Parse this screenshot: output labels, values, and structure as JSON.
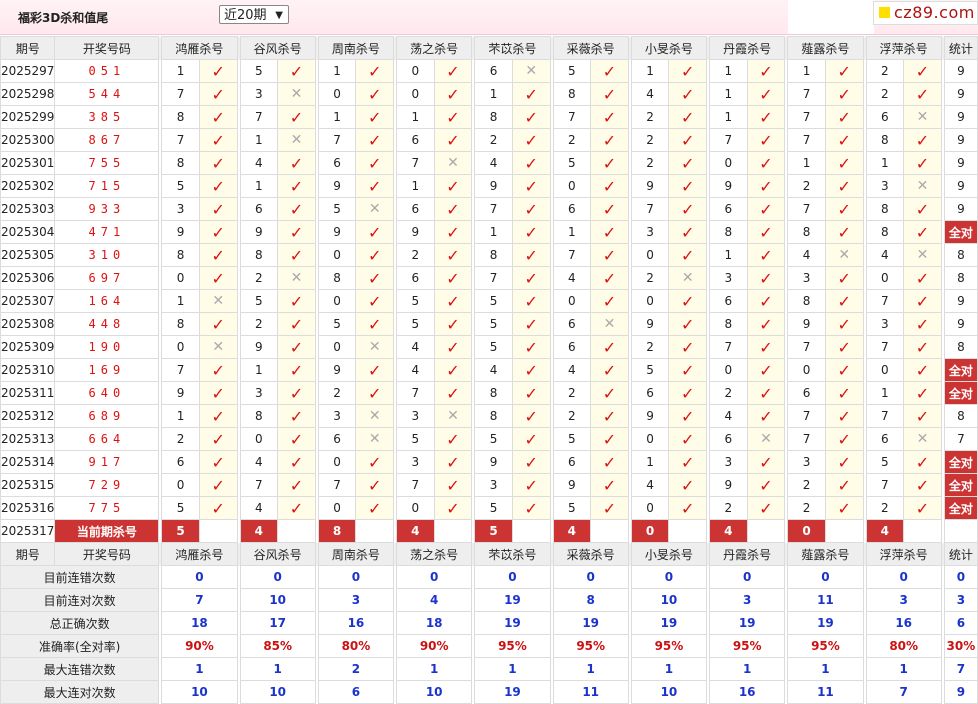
{
  "header": {
    "title": "福彩3D杀和值尾",
    "period_select": "近20期",
    "logo": "cz89.com"
  },
  "table": {
    "col_issue": "期号",
    "col_numbers": "开奖号码",
    "col_stat": "统计",
    "experts": [
      "鸿雁杀号",
      "谷风杀号",
      "周南杀号",
      "荡之杀号",
      "芣苡杀号",
      "采薇杀号",
      "小旻杀号",
      "丹霞杀号",
      "薤露杀号",
      "浮萍杀号"
    ],
    "all_right_label": "全对",
    "rows": [
      {
        "issue": "2025297",
        "numbers": "051",
        "kills": [
          1,
          5,
          1,
          0,
          6,
          5,
          1,
          1,
          1,
          2
        ],
        "hit": [
          1,
          1,
          1,
          1,
          0,
          1,
          1,
          1,
          1,
          1
        ],
        "stat": "9"
      },
      {
        "issue": "2025298",
        "numbers": "544",
        "kills": [
          7,
          3,
          0,
          0,
          1,
          8,
          4,
          1,
          7,
          2
        ],
        "hit": [
          1,
          0,
          1,
          1,
          1,
          1,
          1,
          1,
          1,
          1
        ],
        "stat": "9"
      },
      {
        "issue": "2025299",
        "numbers": "385",
        "kills": [
          8,
          7,
          1,
          1,
          8,
          7,
          2,
          1,
          7,
          6
        ],
        "hit": [
          1,
          1,
          1,
          1,
          1,
          1,
          1,
          1,
          1,
          0
        ],
        "stat": "9"
      },
      {
        "issue": "2025300",
        "numbers": "867",
        "kills": [
          7,
          1,
          7,
          6,
          2,
          2,
          2,
          7,
          7,
          8
        ],
        "hit": [
          1,
          0,
          1,
          1,
          1,
          1,
          1,
          1,
          1,
          1
        ],
        "stat": "9"
      },
      {
        "issue": "2025301",
        "numbers": "755",
        "kills": [
          8,
          4,
          6,
          7,
          4,
          5,
          2,
          0,
          1,
          1
        ],
        "hit": [
          1,
          1,
          1,
          0,
          1,
          1,
          1,
          1,
          1,
          1
        ],
        "stat": "9"
      },
      {
        "issue": "2025302",
        "numbers": "715",
        "kills": [
          5,
          1,
          9,
          1,
          9,
          0,
          9,
          9,
          2,
          3
        ],
        "hit": [
          1,
          1,
          1,
          1,
          1,
          1,
          1,
          1,
          1,
          0
        ],
        "stat": "9"
      },
      {
        "issue": "2025303",
        "numbers": "933",
        "kills": [
          3,
          6,
          5,
          6,
          7,
          6,
          7,
          6,
          7,
          8
        ],
        "hit": [
          1,
          1,
          0,
          1,
          1,
          1,
          1,
          1,
          1,
          1
        ],
        "stat": "9"
      },
      {
        "issue": "2025304",
        "numbers": "471",
        "kills": [
          9,
          9,
          9,
          9,
          1,
          1,
          3,
          8,
          8,
          8
        ],
        "hit": [
          1,
          1,
          1,
          1,
          1,
          1,
          1,
          1,
          1,
          1
        ],
        "stat": "全对"
      },
      {
        "issue": "2025305",
        "numbers": "310",
        "kills": [
          8,
          8,
          0,
          2,
          8,
          7,
          0,
          1,
          4,
          4
        ],
        "hit": [
          1,
          1,
          1,
          1,
          1,
          1,
          1,
          1,
          0,
          0
        ],
        "stat": "8"
      },
      {
        "issue": "2025306",
        "numbers": "697",
        "kills": [
          0,
          2,
          8,
          6,
          7,
          4,
          2,
          3,
          3,
          0
        ],
        "hit": [
          1,
          0,
          1,
          1,
          1,
          1,
          0,
          1,
          1,
          1
        ],
        "stat": "8"
      },
      {
        "issue": "2025307",
        "numbers": "164",
        "kills": [
          1,
          5,
          0,
          5,
          5,
          0,
          0,
          6,
          8,
          7
        ],
        "hit": [
          0,
          1,
          1,
          1,
          1,
          1,
          1,
          1,
          1,
          1
        ],
        "stat": "9"
      },
      {
        "issue": "2025308",
        "numbers": "448",
        "kills": [
          8,
          2,
          5,
          5,
          5,
          6,
          9,
          8,
          9,
          3
        ],
        "hit": [
          1,
          1,
          1,
          1,
          1,
          0,
          1,
          1,
          1,
          1
        ],
        "stat": "9"
      },
      {
        "issue": "2025309",
        "numbers": "190",
        "kills": [
          0,
          9,
          0,
          4,
          5,
          6,
          2,
          7,
          7,
          7
        ],
        "hit": [
          0,
          1,
          0,
          1,
          1,
          1,
          1,
          1,
          1,
          1
        ],
        "stat": "8"
      },
      {
        "issue": "2025310",
        "numbers": "169",
        "kills": [
          7,
          1,
          9,
          4,
          4,
          4,
          5,
          0,
          0,
          0
        ],
        "hit": [
          1,
          1,
          1,
          1,
          1,
          1,
          1,
          1,
          1,
          1
        ],
        "stat": "全对"
      },
      {
        "issue": "2025311",
        "numbers": "640",
        "kills": [
          9,
          3,
          2,
          7,
          8,
          2,
          6,
          2,
          6,
          1
        ],
        "hit": [
          1,
          1,
          1,
          1,
          1,
          1,
          1,
          1,
          1,
          1
        ],
        "stat": "全对"
      },
      {
        "issue": "2025312",
        "numbers": "689",
        "kills": [
          1,
          8,
          3,
          3,
          8,
          2,
          9,
          4,
          7,
          7
        ],
        "hit": [
          1,
          1,
          0,
          0,
          1,
          1,
          1,
          1,
          1,
          1
        ],
        "stat": "8"
      },
      {
        "issue": "2025313",
        "numbers": "664",
        "kills": [
          2,
          0,
          6,
          5,
          5,
          5,
          0,
          6,
          7,
          6
        ],
        "hit": [
          1,
          1,
          0,
          1,
          1,
          1,
          1,
          0,
          1,
          0
        ],
        "stat": "7"
      },
      {
        "issue": "2025314",
        "numbers": "917",
        "kills": [
          6,
          4,
          0,
          3,
          9,
          6,
          1,
          3,
          3,
          5
        ],
        "hit": [
          1,
          1,
          1,
          1,
          1,
          1,
          1,
          1,
          1,
          1
        ],
        "stat": "全对"
      },
      {
        "issue": "2025315",
        "numbers": "729",
        "kills": [
          0,
          7,
          7,
          7,
          3,
          9,
          4,
          9,
          2,
          7
        ],
        "hit": [
          1,
          1,
          1,
          1,
          1,
          1,
          1,
          1,
          1,
          1
        ],
        "stat": "全对"
      },
      {
        "issue": "2025316",
        "numbers": "775",
        "kills": [
          5,
          4,
          0,
          0,
          5,
          5,
          0,
          2,
          2,
          2
        ],
        "hit": [
          1,
          1,
          1,
          1,
          1,
          1,
          1,
          1,
          1,
          1
        ],
        "stat": "全对"
      }
    ],
    "current": {
      "issue": "2025317",
      "label": "当前期杀号",
      "kills": [
        "5",
        "4",
        "8",
        "4",
        "5",
        "4",
        "0",
        "4",
        "0",
        "4"
      ]
    }
  },
  "stats": {
    "rows": [
      {
        "label": "目前连错次数",
        "values": [
          "0",
          "0",
          "0",
          "0",
          "0",
          "0",
          "0",
          "0",
          "0",
          "0"
        ],
        "total": "0",
        "color": "blue"
      },
      {
        "label": "目前连对次数",
        "values": [
          "7",
          "10",
          "3",
          "4",
          "19",
          "8",
          "10",
          "3",
          "11",
          "3"
        ],
        "total": "3",
        "color": "blue"
      },
      {
        "label": "总正确次数",
        "values": [
          "18",
          "17",
          "16",
          "18",
          "19",
          "19",
          "19",
          "19",
          "19",
          "16"
        ],
        "total": "6",
        "color": "blue"
      },
      {
        "label": "准确率(全对率)",
        "values": [
          "90%",
          "85%",
          "80%",
          "90%",
          "95%",
          "95%",
          "95%",
          "95%",
          "95%",
          "80%"
        ],
        "total": "30%",
        "color": "red"
      },
      {
        "label": "最大连错次数",
        "values": [
          "1",
          "1",
          "2",
          "1",
          "1",
          "1",
          "1",
          "1",
          "1",
          "1"
        ],
        "total": "7",
        "color": "blue"
      },
      {
        "label": "最大连对次数",
        "values": [
          "10",
          "10",
          "6",
          "10",
          "19",
          "11",
          "10",
          "16",
          "11",
          "7"
        ],
        "total": "9",
        "color": "blue"
      }
    ]
  }
}
